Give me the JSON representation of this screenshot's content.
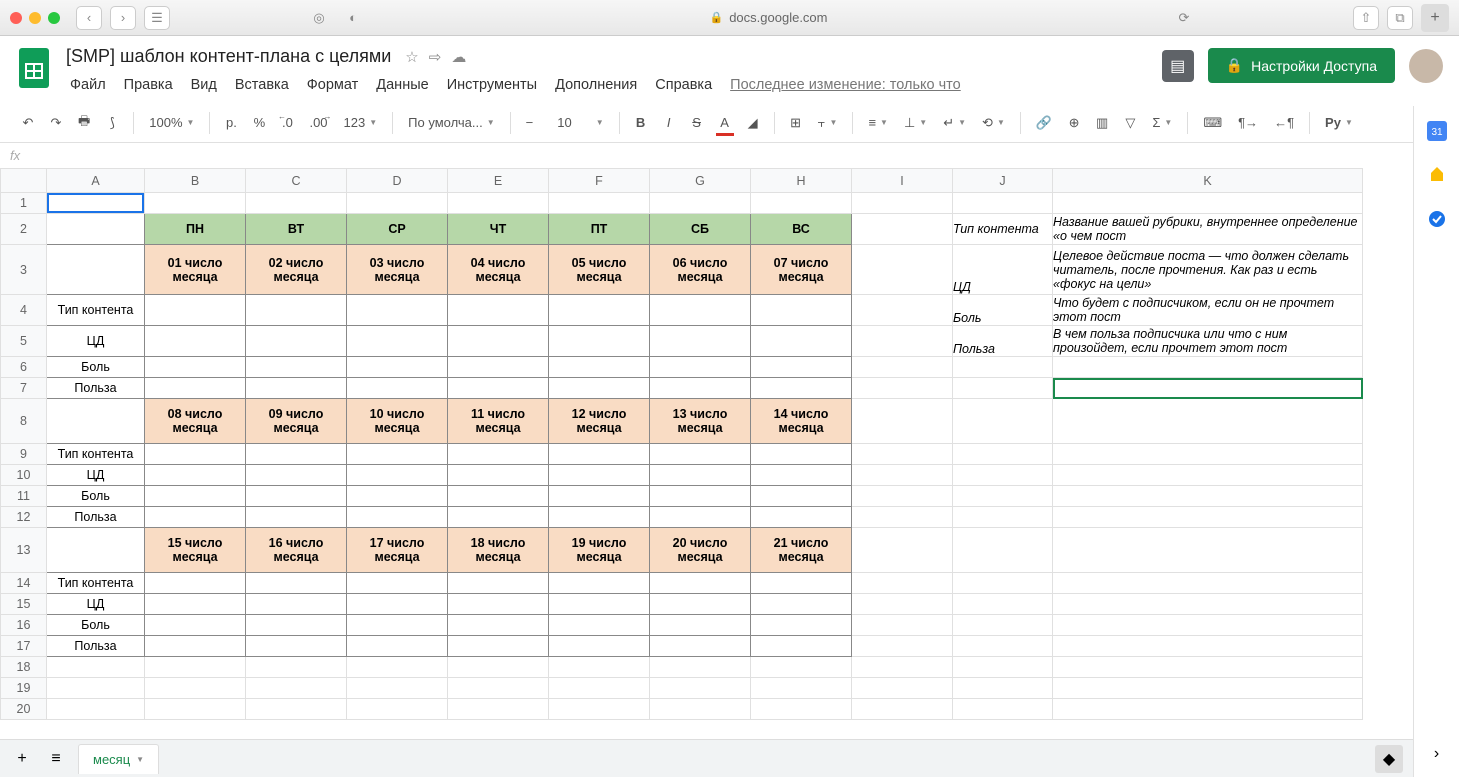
{
  "browser": {
    "url": "docs.google.com"
  },
  "doc": {
    "title": "[SMP] шаблон контент-плана с целями",
    "menu": {
      "file": "Файл",
      "edit": "Правка",
      "view": "Вид",
      "insert": "Вставка",
      "format": "Формат",
      "data": "Данные",
      "tools": "Инструменты",
      "addons": "Дополнения",
      "help": "Справка"
    },
    "last_edit": "Последнее изменение: только что",
    "share": "Настройки Доступа"
  },
  "toolbar": {
    "zoom": "100%",
    "currency": "р.",
    "percent": "%",
    "dec_dec": ".0",
    "dec_inc": ".00",
    "num": "123",
    "font": "По умолча...",
    "size": "10",
    "py": "Py"
  },
  "sheet": {
    "columns": [
      "A",
      "B",
      "C",
      "D",
      "E",
      "F",
      "G",
      "H",
      "I",
      "J",
      "K"
    ],
    "days": {
      "b": "ПН",
      "c": "ВТ",
      "d": "СР",
      "e": "ЧТ",
      "f": "ПТ",
      "g": "СБ",
      "h": "ВС"
    },
    "dates1": {
      "b": "01 число месяца",
      "c": "02 число месяца",
      "d": "03 число месяца",
      "e": "04 число месяца",
      "f": "05 число месяца",
      "g": "06 число месяца",
      "h": "07 число месяца"
    },
    "dates2": {
      "b": "08 число месяца",
      "c": "09 число месяца",
      "d": "10 число месяца",
      "e": "11 число месяца",
      "f": "12 число месяца",
      "g": "13 число месяца",
      "h": "14 число месяца"
    },
    "dates3": {
      "b": "15 число месяца",
      "c": "16 число месяца",
      "d": "17 число месяца",
      "e": "18 число месяца",
      "f": "19 число месяца",
      "g": "20 число месяца",
      "h": "21 число месяца"
    },
    "rowlabels": {
      "type": "Тип контента",
      "cd": "ЦД",
      "pain": "Боль",
      "benefit": "Польза"
    },
    "legend": {
      "j2": "Тип контента",
      "k2": "Название вашей рубрики, внутреннее определение «о чем пост",
      "j3": "ЦД",
      "k3": "Целевое действие поста — что должен сделать читатель, после прочтения. Как раз и есть «фокус на цели»",
      "j4": "Боль",
      "k4": "Что будет с подписчиком, если он не прочтет этот пост",
      "j5": "Польза",
      "k5": "В чем польза подписчика или что с ним произойдет, если прочтет этот пост"
    }
  },
  "tabs": {
    "month": "месяц"
  }
}
